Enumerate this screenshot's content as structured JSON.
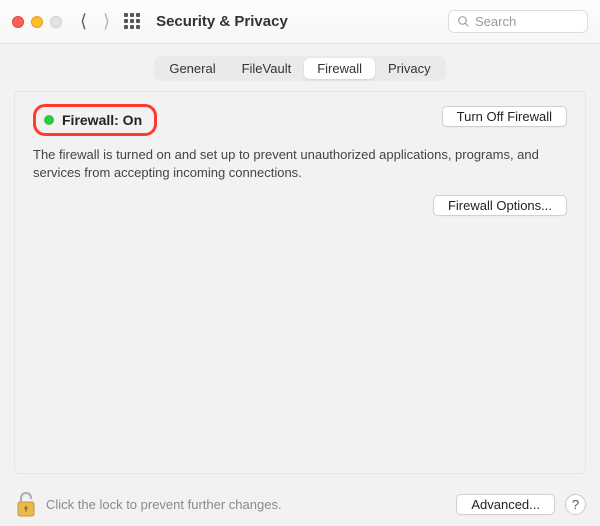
{
  "window": {
    "title": "Security & Privacy"
  },
  "search": {
    "placeholder": "Search"
  },
  "tabs": {
    "general": "General",
    "filevault": "FileVault",
    "firewall": "Firewall",
    "privacy": "Privacy"
  },
  "firewall": {
    "status_label": "Firewall: On",
    "status_color": "#2ac940",
    "turn_off_label": "Turn Off Firewall",
    "description": "The firewall is turned on and set up to prevent unauthorized applications, programs, and services from accepting incoming connections.",
    "options_label": "Firewall Options..."
  },
  "footer": {
    "lock_hint": "Click the lock to prevent further changes.",
    "advanced_label": "Advanced...",
    "help_label": "?"
  },
  "colors": {
    "highlight": "#ff3b30"
  }
}
